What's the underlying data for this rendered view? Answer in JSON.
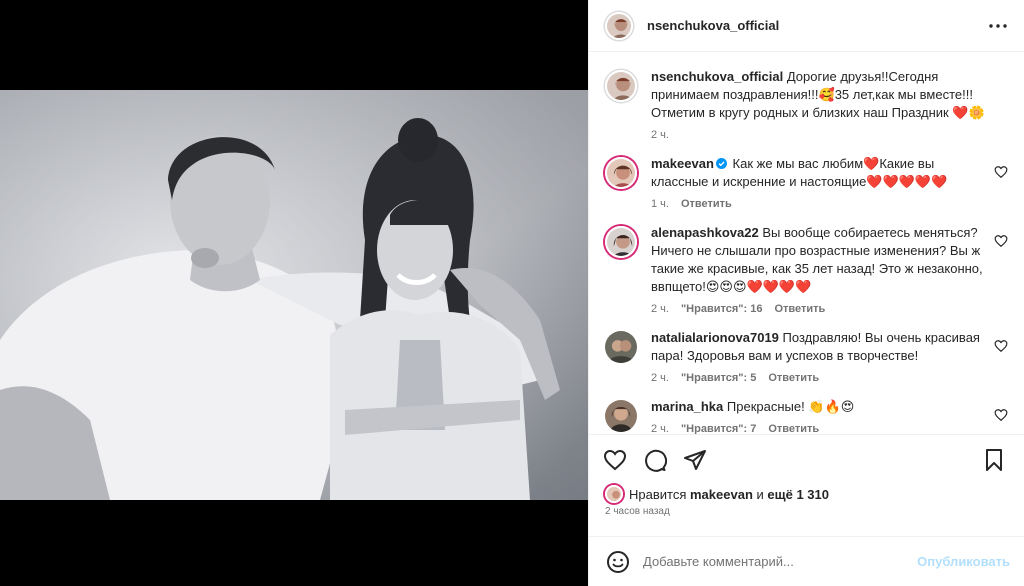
{
  "post": {
    "author": "nsenchukova_official",
    "caption": "Дорогие друзья!!Сегодня принимаем поздравления!!!🥰35 лет,как мы вместе!!!Отметим в кругу родных и близких наш Праздник ❤️🌼",
    "caption_time": "2 ч."
  },
  "comments": [
    {
      "user": "makeevan",
      "verified": true,
      "text": "Как же мы вас любим❤️Какие вы классные и искренние и настоящие❤️❤️❤️❤️❤️",
      "time": "1 ч.",
      "likes": "",
      "reply": "Ответить"
    },
    {
      "user": "alenapashkova22",
      "verified": false,
      "text": "Вы вообще собираетесь меняться? Ничего не слышали про возрастные изменения? Вы ж такие же красивые, как 35 лет назад! Это ж незаконно, ввпщето!😍😍😍❤️❤️❤️❤️",
      "time": "2 ч.",
      "likes": "\"Нравится\": 16",
      "reply": "Ответить"
    },
    {
      "user": "natalialarionova7019",
      "verified": false,
      "text": "Поздравляю! Вы очень красивая пара! Здоровья вам и успехов в творчестве!",
      "time": "2 ч.",
      "likes": "\"Нравится\": 5",
      "reply": "Ответить"
    },
    {
      "user": "marina_hka",
      "verified": false,
      "text": "Прекрасные! 👏🔥😍",
      "time": "2 ч.",
      "likes": "\"Нравится\": 7",
      "reply": "Ответить"
    }
  ],
  "likes": {
    "prefix": "Нравится",
    "user": "makeevan",
    "conj": "и",
    "rest": "ещё 1 310"
  },
  "posted_ago": "2 часов назад",
  "compose": {
    "placeholder": "Добавьте комментарий...",
    "publish": "Опубликовать"
  },
  "icons": [
    "more-icon",
    "heart-icon",
    "comment-icon",
    "share-icon",
    "save-icon",
    "emoji-icon",
    "verified-icon"
  ],
  "colors": {
    "accent_disabled": "#b2dffc",
    "verified": "#0095f6",
    "muted": "#737373"
  }
}
